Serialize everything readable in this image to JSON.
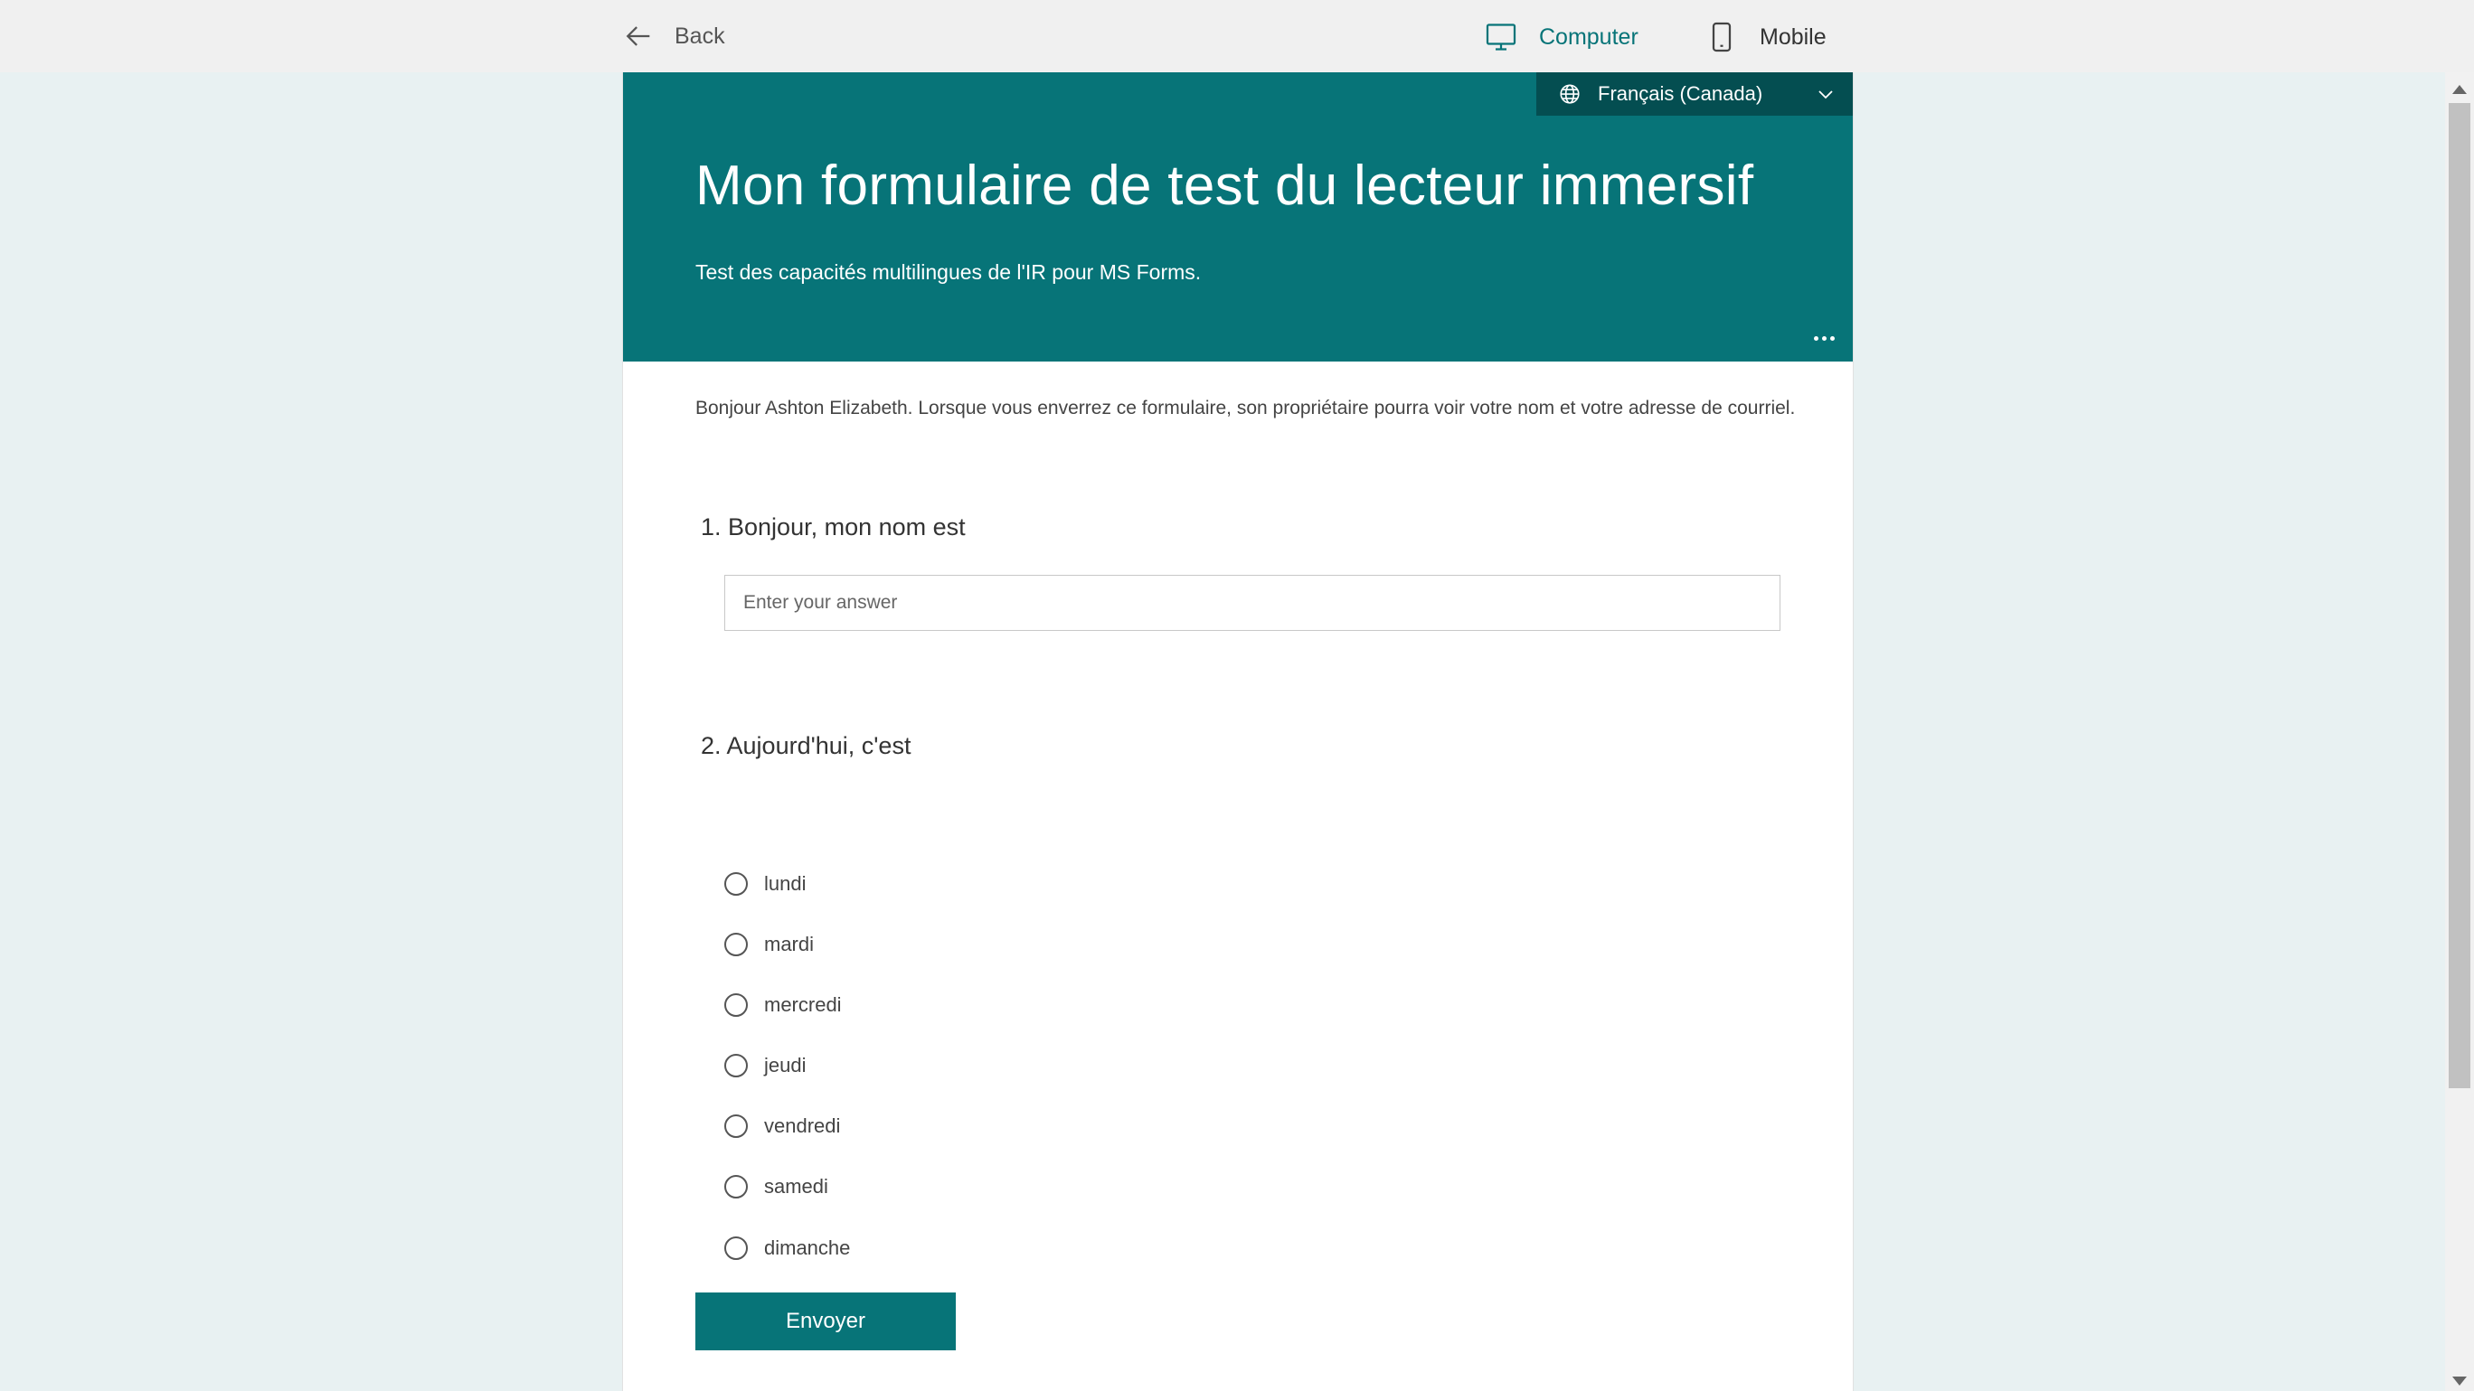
{
  "topbar": {
    "back_label": "Back",
    "view_computer_label": "Computer",
    "view_mobile_label": "Mobile",
    "active_view": "Computer"
  },
  "form": {
    "language": "Français (Canada)",
    "title": "Mon formulaire de test du lecteur immersif",
    "subtitle": "Test des capacités multilingues de l'IR pour MS Forms.",
    "intro": "Bonjour Ashton Elizabeth. Lorsque vous enverrez ce formulaire, son propriétaire pourra voir votre nom et votre adresse de courriel.",
    "questions": [
      {
        "number": "1.",
        "title": "1. Bonjour, mon nom est",
        "placeholder": "Enter your answer",
        "value": ""
      },
      {
        "number": "2.",
        "title": "2. Aujourd'hui, c'est",
        "options": [
          "lundi",
          "mardi",
          "mercredi",
          "jeudi",
          "vendredi",
          "samedi",
          "dimanche"
        ],
        "selected": null
      }
    ],
    "submit_label": "Envoyer"
  },
  "colors": {
    "accent": "#077478",
    "accent_dark": "#044e51",
    "page_background": "#e8f1f2",
    "topbar_background": "#f0f0f0"
  },
  "icons": {
    "back": "arrow-left-icon",
    "computer": "monitor-icon",
    "mobile": "phone-icon",
    "language": "globe-icon",
    "dropdown": "chevron-down-icon",
    "more": "more-dots-icon"
  }
}
